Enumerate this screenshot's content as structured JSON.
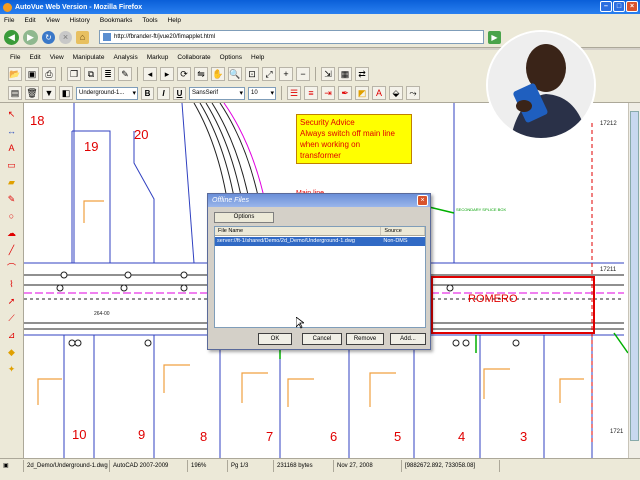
{
  "window": {
    "title": "AutoVue Web Version - Mozilla Firefox"
  },
  "browser_menu": [
    "File",
    "Edit",
    "View",
    "History",
    "Bookmarks",
    "Tools",
    "Help"
  ],
  "browser_nav": {
    "url": "http://fbrander-ft/jvue20/fimapplet.html"
  },
  "app_menu": [
    "File",
    "Edit",
    "View",
    "Manipulate",
    "Analysis",
    "Markup",
    "Collaborate",
    "Options",
    "Help"
  ],
  "format_bar": {
    "layer": "Underground-1...",
    "font": "SansSerif",
    "size": "10",
    "bold": "B",
    "italic": "I",
    "underline": "U"
  },
  "note": {
    "lines": [
      "Security Advice",
      "Always switch off main line",
      "when working on",
      "transformer"
    ]
  },
  "drawing": {
    "lot_numbers_top": [
      "18",
      "19",
      "20"
    ],
    "lot_numbers_bottom": [
      "10",
      "9",
      "8",
      "7",
      "6",
      "5",
      "4",
      "3"
    ],
    "street_name": "ROMERO",
    "main_line_label": "Main line",
    "secondary_label": "SECONDARY SPLICE BOX",
    "dim_label": "264-00",
    "side_labels": [
      "17212",
      "17211",
      "1721"
    ],
    "colors": {
      "lot_red": "#e00000",
      "line_blue": "#3040c0",
      "accent_magenta": "#e000e0",
      "accent_green": "#00b000",
      "accent_orange": "#f0a040"
    }
  },
  "dialog": {
    "title": "Offline Files",
    "tab": "Options",
    "columns": [
      "File Name",
      "Source"
    ],
    "rows": [
      {
        "file": "server://ft-1/shared/Demo/2d_Demo/Underground-1.dwg",
        "source": "Non-DMS"
      }
    ],
    "buttons": {
      "ok": "OK",
      "cancel": "Cancel",
      "remove": "Remove",
      "add": "Add..."
    }
  },
  "status": {
    "file": "2d_Demo/Underground-1.dwg",
    "format": "AutoCAD 2007-2009",
    "zoom": "196%",
    "page": "Pg 1/3",
    "size": "231168 bytes",
    "date": "Nov 27, 2008",
    "coords": "[9882672.892, 733058.08]"
  }
}
